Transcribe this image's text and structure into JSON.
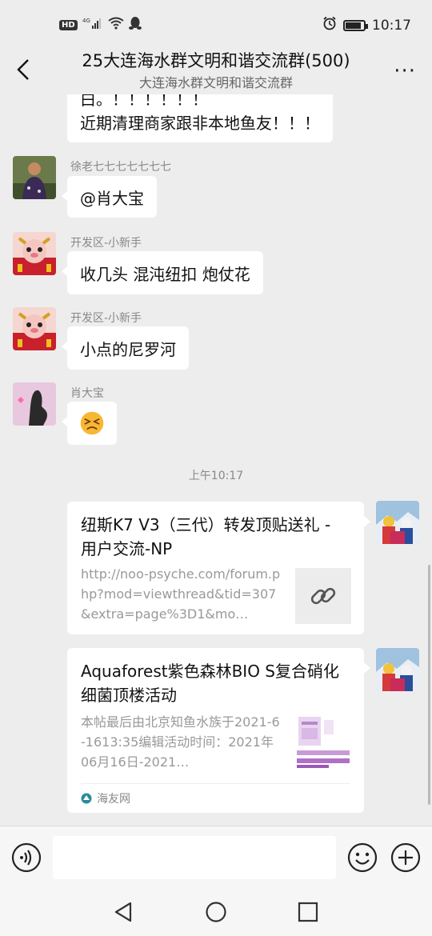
{
  "status_bar": {
    "hd": "HD",
    "network": "4G",
    "time": "10:17",
    "battery_level": 0.85
  },
  "header": {
    "title": "25大连海水群文明和谐交流群(500)",
    "subtitle": "大连海水群文明和谐交流群",
    "more_label": "···"
  },
  "messages": [
    {
      "type": "text",
      "text_line1": "白。！！！！！！",
      "text_line2": "近期清理商家跟非本地鱼友！！！"
    },
    {
      "type": "text",
      "sender": "徐老七七七七七七七",
      "text": "@肖大宝"
    },
    {
      "type": "text",
      "sender": "开发区-小新手",
      "text": "收几头  混沌纽扣  炮仗花"
    },
    {
      "type": "text",
      "sender": "开发区-小新手",
      "text": "小点的尼罗河"
    },
    {
      "type": "emoji",
      "sender": "肖大宝",
      "emoji": "😣"
    }
  ],
  "timestamp": "上午10:17",
  "cards": [
    {
      "title": "纽斯K7 V3（三代）转发顶贴送礼 - 用户交流-NP",
      "desc": "http://noo-psyche.com/forum.php?mod=viewthread&tid=307&extra=page%3D1&mo…",
      "thumb_icon": "link-icon"
    },
    {
      "title": "Aquaforest紫色森林BIO S复合硝化细菌顶楼活动",
      "desc": "本帖最后由北京知鱼水族于2021-6-1613:35编辑活动时间：2021年06月16日-2021…",
      "source": "海友网",
      "thumb_icon": "article-thumbnail"
    }
  ],
  "colors": {
    "bg": "#ededed",
    "bubble": "#ffffff",
    "accent": "#07c160"
  }
}
